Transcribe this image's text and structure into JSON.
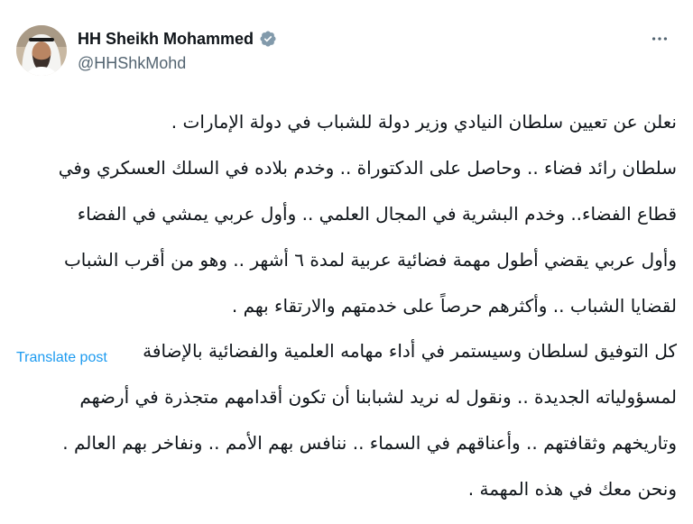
{
  "post": {
    "author": {
      "display_name": "HH Sheikh Mohammed",
      "handle": "@HHShkMohd",
      "verified_icon": "verified-badge-icon"
    },
    "more_icon": "more-options-icon",
    "text_lines": [
      "نعلن عن تعيين سلطان النيادي وزير دولة للشباب في دولة الإمارات .",
      "سلطان رائد فضاء .. وحاصل على الدكتوراة .. وخدم بلاده في السلك العسكري وفي",
      "قطاع الفضاء.. وخدم البشرية في المجال العلمي .. وأول عربي يمشي في الفضاء",
      "وأول عربي يقضي أطول مهمة فضائية عربية لمدة ٦ أشهر .. وهو من أقرب الشباب",
      "لقضايا الشباب .. وأكثرهم حرصاً على خدمتهم والارتقاء بهم .",
      "كل التوفيق لسلطان وسيستمر في أداء مهامه العلمية والفضائية بالإضافة",
      "لمسؤولياته الجديدة .. ونقول له نريد لشبابنا أن تكون أقدامهم متجذرة في أرضهم",
      "وتاريخهم وثقافتهم .. وأعناقهم في السماء .. ننافس بهم الأمم .. ونفاخر بهم العالم .",
      "ونحن معك في هذه المهمة ."
    ],
    "translate_label": "Translate post",
    "colors": {
      "link": "#1d9bf0",
      "verified": "#829aab",
      "secondary_text": "#536471"
    }
  }
}
